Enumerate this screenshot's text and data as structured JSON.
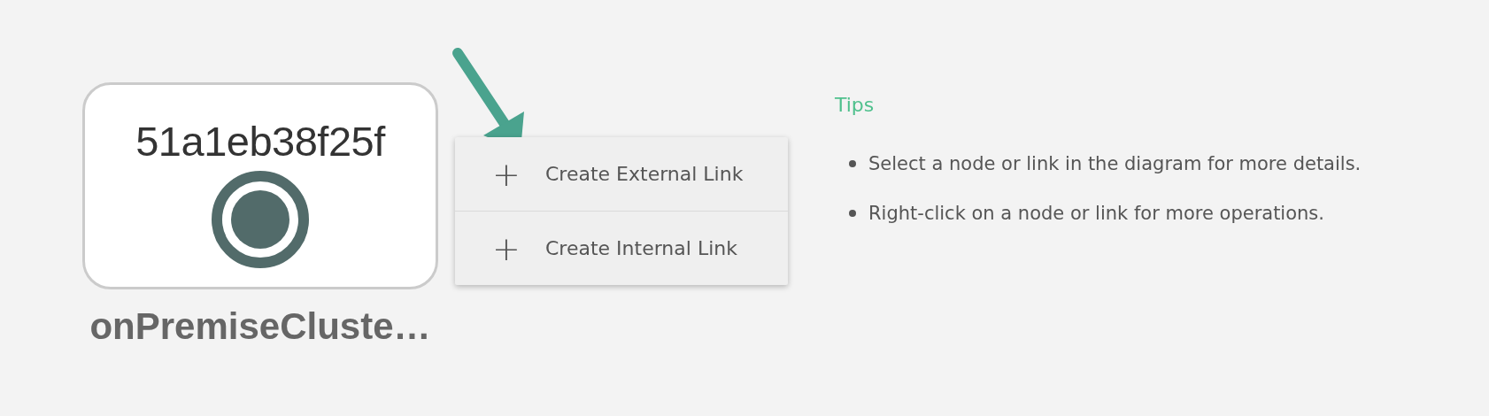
{
  "node": {
    "title": "51a1eb38f25f",
    "label": "onPremiseCluste…"
  },
  "context_menu": {
    "items": [
      {
        "icon": "+",
        "label": "Create External Link"
      },
      {
        "icon": "+",
        "label": "Create Internal Link"
      }
    ]
  },
  "tips": {
    "title": "Tips",
    "items": [
      "Select a node or link in the diagram for more details.",
      "Right-click on a node or link for more operations."
    ]
  }
}
